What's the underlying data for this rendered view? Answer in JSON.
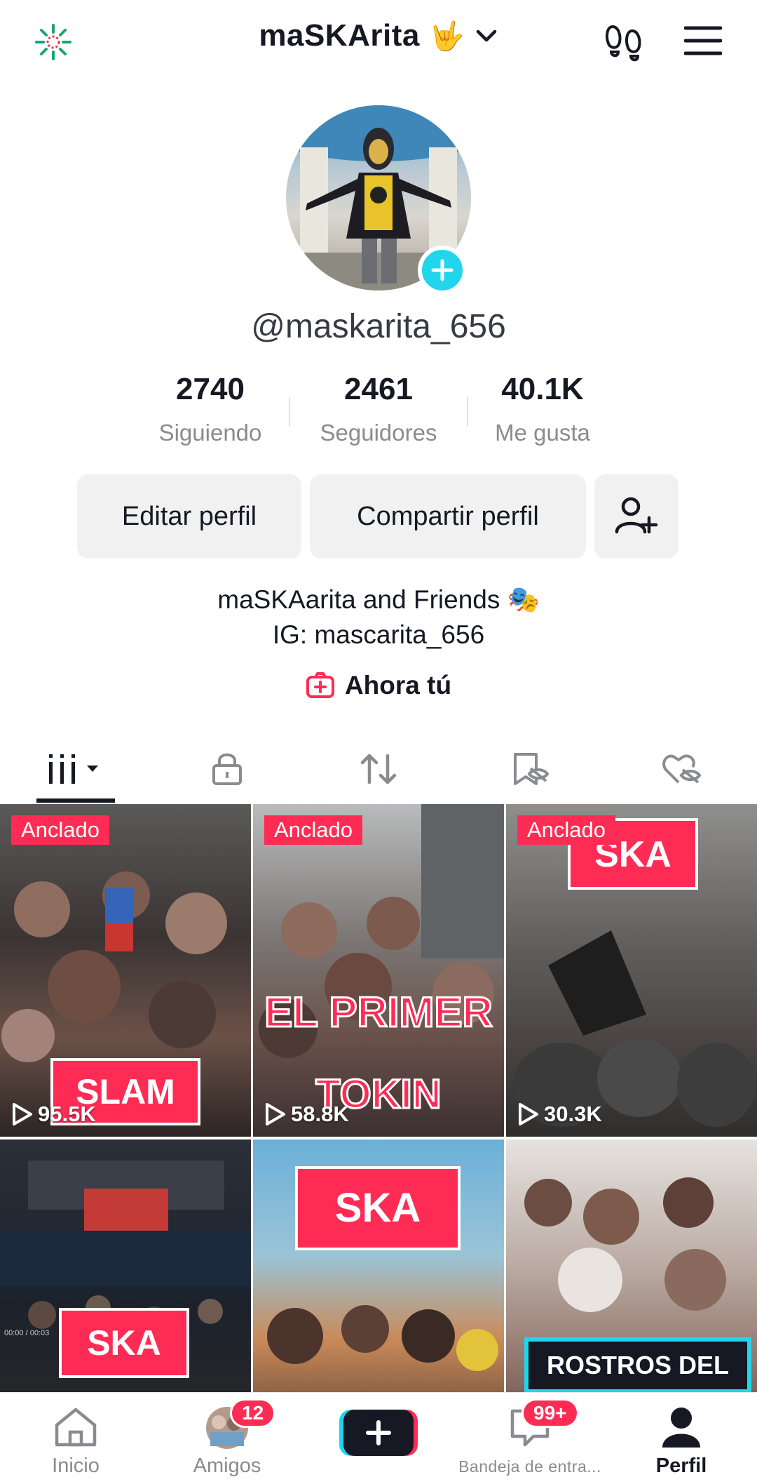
{
  "header": {
    "title": "maSKArita",
    "title_emoji": "🤟",
    "left_icon": "sparkle-icon",
    "right_icons": [
      "footprints-icon",
      "menu-icon"
    ]
  },
  "profile": {
    "username": "@maskarita_656",
    "stats": [
      {
        "value": "2740",
        "label": "Siguiendo"
      },
      {
        "value": "2461",
        "label": "Seguidores"
      },
      {
        "value": "40.1K",
        "label": "Me gusta"
      }
    ],
    "buttons": {
      "edit": "Editar perfil",
      "share": "Compartir perfil"
    },
    "bio_line1": "maSKAarita and Friends 🎭",
    "bio_line2": "IG: mascarita_656",
    "ahora_tu": "Ahora tú"
  },
  "tabs": [
    "videos-grid-icon",
    "lock-icon",
    "repost-icon",
    "favorites-icon",
    "liked-icon"
  ],
  "videos": [
    {
      "pinned_label": "Anclado",
      "views": "95.5K",
      "overlay_text": "SLAM"
    },
    {
      "pinned_label": "Anclado",
      "views": "58.8K",
      "overlay_text": "EL PRIMER",
      "overlay_text2": "TOKIN"
    },
    {
      "pinned_label": "Anclado",
      "views": "30.3K",
      "overlay_text": "SKA"
    },
    {
      "overlay_text": "SKA",
      "mini_text": "00:00 / 00:03"
    },
    {
      "overlay_text": "SKA"
    },
    {
      "overlay_text": "ROSTROS DEL"
    }
  ],
  "bottom_nav": {
    "items": [
      {
        "label": "Inicio",
        "icon": "home-icon"
      },
      {
        "label": "Amigos",
        "icon": "friends-avatar",
        "badge": "12"
      },
      {
        "label": "",
        "icon": "create-plus-icon"
      },
      {
        "label": "Bandeja de entra...",
        "icon": "inbox-icon",
        "badge": "99+"
      },
      {
        "label": "Perfil",
        "icon": "profile-icon"
      }
    ]
  },
  "colors": {
    "accent": "#fe2c55",
    "cyan": "#20d5ec",
    "text": "#161823",
    "muted": "#8a8b91",
    "button_bg": "#f1f1f2"
  }
}
